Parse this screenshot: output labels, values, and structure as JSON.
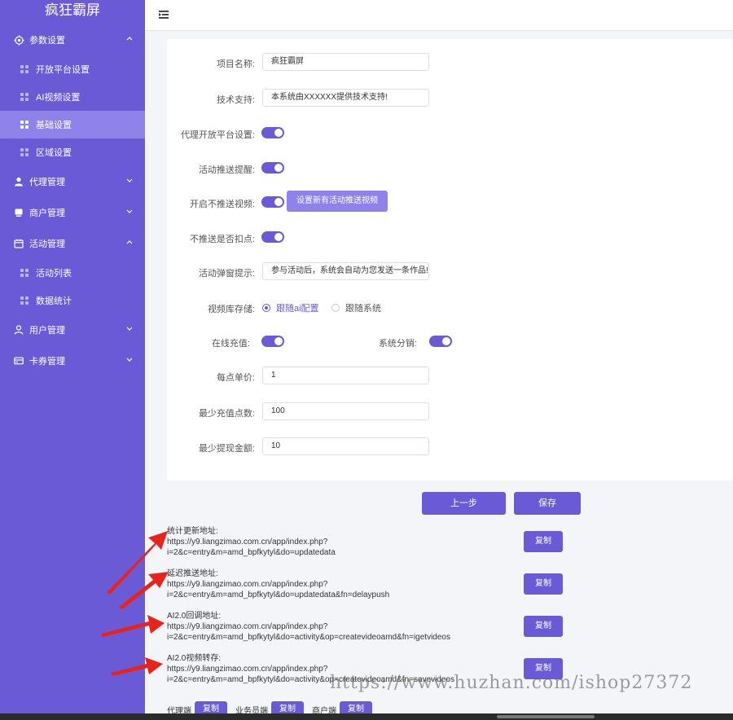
{
  "brand": "疯狂霸屏",
  "sidebar": {
    "groups": [
      {
        "label": "参数设置",
        "icon": "gear-icon",
        "expanded": true,
        "items": [
          {
            "label": "开放平台设置"
          },
          {
            "label": "AI视频设置"
          },
          {
            "label": "基础设置",
            "active": true
          },
          {
            "label": "区域设置"
          }
        ]
      },
      {
        "label": "代理管理",
        "icon": "user-icon",
        "expanded": false
      },
      {
        "label": "商户管理",
        "icon": "store-icon",
        "expanded": false
      },
      {
        "label": "活动管理",
        "icon": "calendar-icon",
        "expanded": true,
        "items": [
          {
            "label": "活动列表"
          },
          {
            "label": "数据统计"
          }
        ]
      },
      {
        "label": "用户管理",
        "icon": "person-icon",
        "expanded": false
      },
      {
        "label": "卡券管理",
        "icon": "card-icon",
        "expanded": false
      }
    ]
  },
  "form": {
    "project_name": {
      "label": "项目名称:",
      "value": "疯狂霸屏"
    },
    "tech_support": {
      "label": "技术支持:",
      "value": "本系统由XXXXXX提供技术支持!"
    },
    "agent_platform": {
      "label": "代理开放平台设置:",
      "on": true
    },
    "activity_push": {
      "label": "活动推送提醒:",
      "on": true
    },
    "no_push_video": {
      "label": "开启不推送视频:",
      "on": true,
      "button": "设置新有活动推送视频"
    },
    "no_push_deduct": {
      "label": "不推送是否扣点:",
      "on": true
    },
    "popup_tip": {
      "label": "活动弹窗提示:",
      "value": "参与活动后，系统会自动为您发送一条作品!"
    },
    "video_storage": {
      "label": "视频库存储:",
      "options": [
        "跟随ai配置",
        "跟随系统"
      ],
      "selected": "跟随ai配置"
    },
    "online_recharge": {
      "label": "在线充值:",
      "on": true
    },
    "system_distribution": {
      "label": "系统分销:",
      "on": true
    },
    "price_per_point": {
      "label": "每点单价:",
      "value": "1"
    },
    "min_recharge_points": {
      "label": "最少充值点数:",
      "value": "100"
    },
    "min_withdraw": {
      "label": "最少提现金额:",
      "value": "10"
    }
  },
  "actions": {
    "prev": "上一步",
    "save": "保存"
  },
  "urls": [
    {
      "title": "统计更新地址:",
      "line1": "https://y9.liangzimao.com.cn/app/index.php?",
      "line2": "i=2&c=entry&m=amd_bpfkytyl&do=updatedata",
      "copy": "复制"
    },
    {
      "title": "延迟推送地址:",
      "line1": "https://y9.liangzimao.com.cn/app/index.php?",
      "line2": "i=2&c=entry&m=amd_bpfkytyl&do=updatedata&fn=delaypush",
      "copy": "复制"
    },
    {
      "title": "AI2.0回调地址:",
      "line1": "https://y9.liangzimao.com.cn/app/index.php?",
      "line2": "i=2&c=entry&m=amd_bpfkytyl&do=activity&op=createvideoamd&fn=igetvideos",
      "copy": "复制"
    },
    {
      "title": "AI2.0视频转存:",
      "line1": "https://y9.liangzimao.com.cn/app/index.php?",
      "line2": "i=2&c=entry&m=amd_bpfkytyl&do=activity&op=createvideoamd&fn=savevideos",
      "copy": "复制"
    }
  ],
  "footer": [
    {
      "label": "代理端",
      "button": "复制"
    },
    {
      "label": "业务员端",
      "button": "复制"
    },
    {
      "label": "商户端",
      "button": "复制"
    }
  ],
  "watermark": "https://www.huzhan.com/ishop27372",
  "colors": {
    "accent": "#6a5ad6",
    "accent_light": "#8f82ea",
    "arrow": "#e8231c"
  }
}
